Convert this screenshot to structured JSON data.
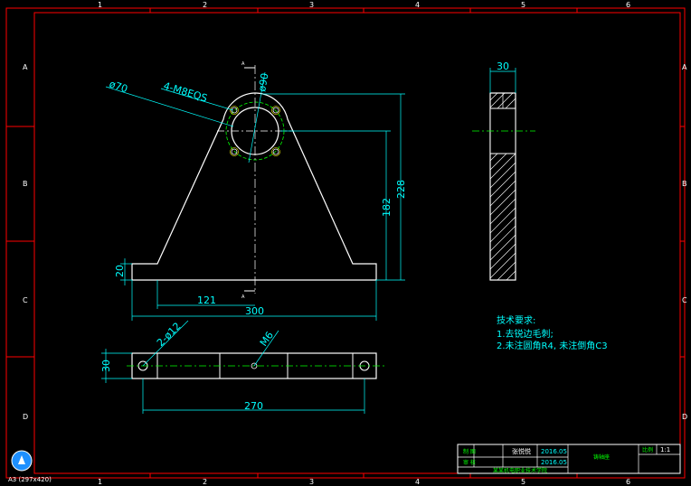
{
  "colors": {
    "background": "#000000",
    "border": "#ff0000",
    "outline": "#ffffff",
    "dimension": "#00ffff",
    "centerline": "#00ff00",
    "thread": "#ffff00"
  },
  "zones": {
    "columns": [
      "1",
      "2",
      "3",
      "4",
      "5",
      "6"
    ],
    "rows": [
      "A",
      "B",
      "C",
      "D"
    ]
  },
  "front_view": {
    "dims": {
      "d70": "ø70",
      "holes4": "4-M8EQS",
      "d90": "ø90",
      "h228": "228",
      "h182": "182",
      "h20": "20",
      "w121": "121",
      "w300": "300"
    },
    "section_mark": "A"
  },
  "top_view": {
    "dims": {
      "t30": "30",
      "holes2": "2-ø12",
      "m6": "M6",
      "w270": "270"
    }
  },
  "side_view": {
    "dims": {
      "w30": "30"
    }
  },
  "tech_notes": {
    "title": "技术要求:",
    "line1": "1.去锐边毛刺;",
    "line2": "2.未注圆角R4, 未注倒角C3"
  },
  "title_block": {
    "label_draw": "制  图",
    "label_check": "审  核",
    "drafter": "张悦悦",
    "date1": "2016.05",
    "date2": "2016.05",
    "part_name": "铸轴座",
    "scale_label": "比例",
    "scale": "1:1",
    "school": "某某机电职业技术学院"
  },
  "sheet_label": "A3 (297x420)"
}
